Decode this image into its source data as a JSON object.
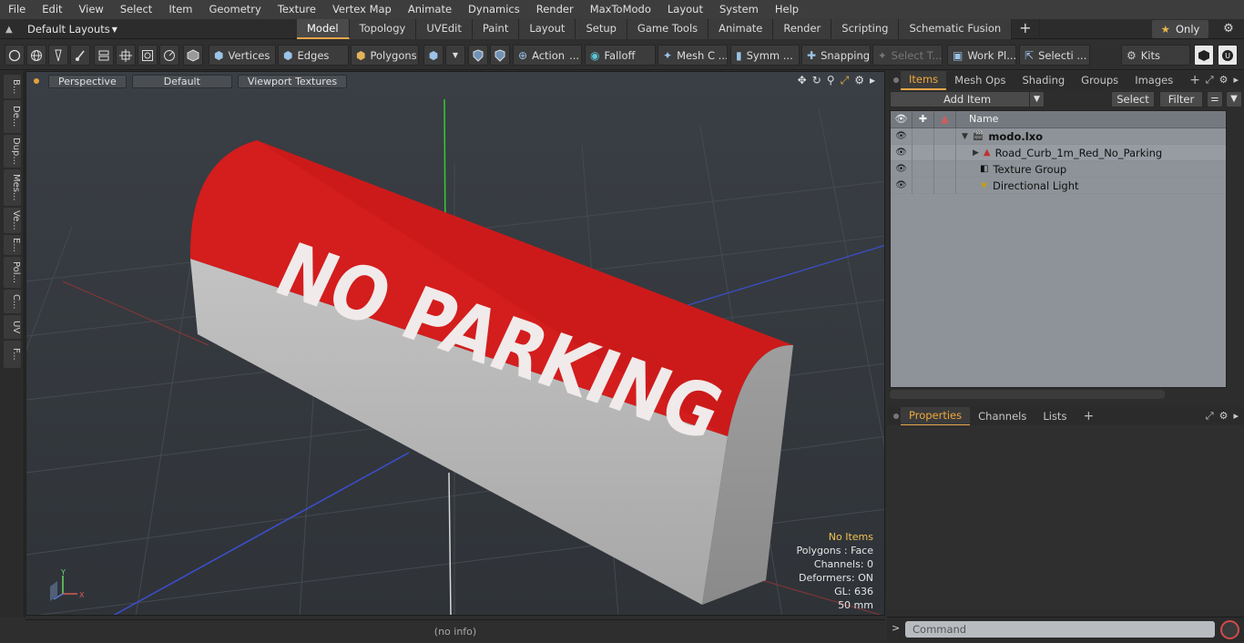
{
  "menu": [
    "File",
    "Edit",
    "View",
    "Select",
    "Item",
    "Geometry",
    "Texture",
    "Vertex Map",
    "Animate",
    "Dynamics",
    "Render",
    "MaxToModo",
    "Layout",
    "System",
    "Help"
  ],
  "layout_selector": "Default Layouts",
  "layout_tabs": [
    "Model",
    "Topology",
    "UVEdit",
    "Paint",
    "Layout",
    "Setup",
    "Game Tools",
    "Animate",
    "Render",
    "Scripting",
    "Schematic Fusion"
  ],
  "active_tab": "Model",
  "only_label": "Only",
  "toolbar": {
    "vertices": "Vertices",
    "edges": "Edges",
    "polygons": "Polygons",
    "action": "Action",
    "falloff": "Falloff",
    "mesh": "Mesh C ...",
    "symm": "Symm ...",
    "snapping": "Snapping",
    "select_t": "Select T...",
    "work_plane": "Work Pl...",
    "selection": "Selecti ...",
    "kits": "Kits"
  },
  "left_tabs": [
    "B...",
    "De...",
    "Dup...",
    "Mes...",
    "Ve...",
    "E...",
    "Pol...",
    "C...",
    "UV",
    "F..."
  ],
  "viewport": {
    "projection": "Perspective",
    "shading": "Default",
    "textures": "Viewport Textures",
    "object_text": "NO PARKING",
    "stats": {
      "selection": "No Items",
      "polygons": "Polygons : Face",
      "channels": "Channels: 0",
      "deformers": "Deformers: ON",
      "gl": "GL: 636",
      "scale": "50 mm"
    }
  },
  "status": "(no info)",
  "items_panel": {
    "tabs": [
      "Items",
      "Mesh Ops",
      "Shading",
      "Groups",
      "Images"
    ],
    "active": "Items",
    "add_item": "Add Item",
    "select": "Select",
    "filter": "Filter",
    "column_name": "Name",
    "tree": [
      {
        "label": "modo.lxo",
        "level": 0
      },
      {
        "label": "Road_Curb_1m_Red_No_Parking",
        "level": 1
      },
      {
        "label": "Texture Group",
        "level": 1
      },
      {
        "label": "Directional Light",
        "level": 1
      }
    ]
  },
  "properties_panel": {
    "tabs": [
      "Properties",
      "Channels",
      "Lists"
    ],
    "active": "Properties"
  },
  "command": {
    "placeholder": "Command"
  },
  "colors": {
    "accent": "#e8a64b",
    "curb_red": "#d21c1c",
    "curb_grey": "#b9b9b9"
  }
}
